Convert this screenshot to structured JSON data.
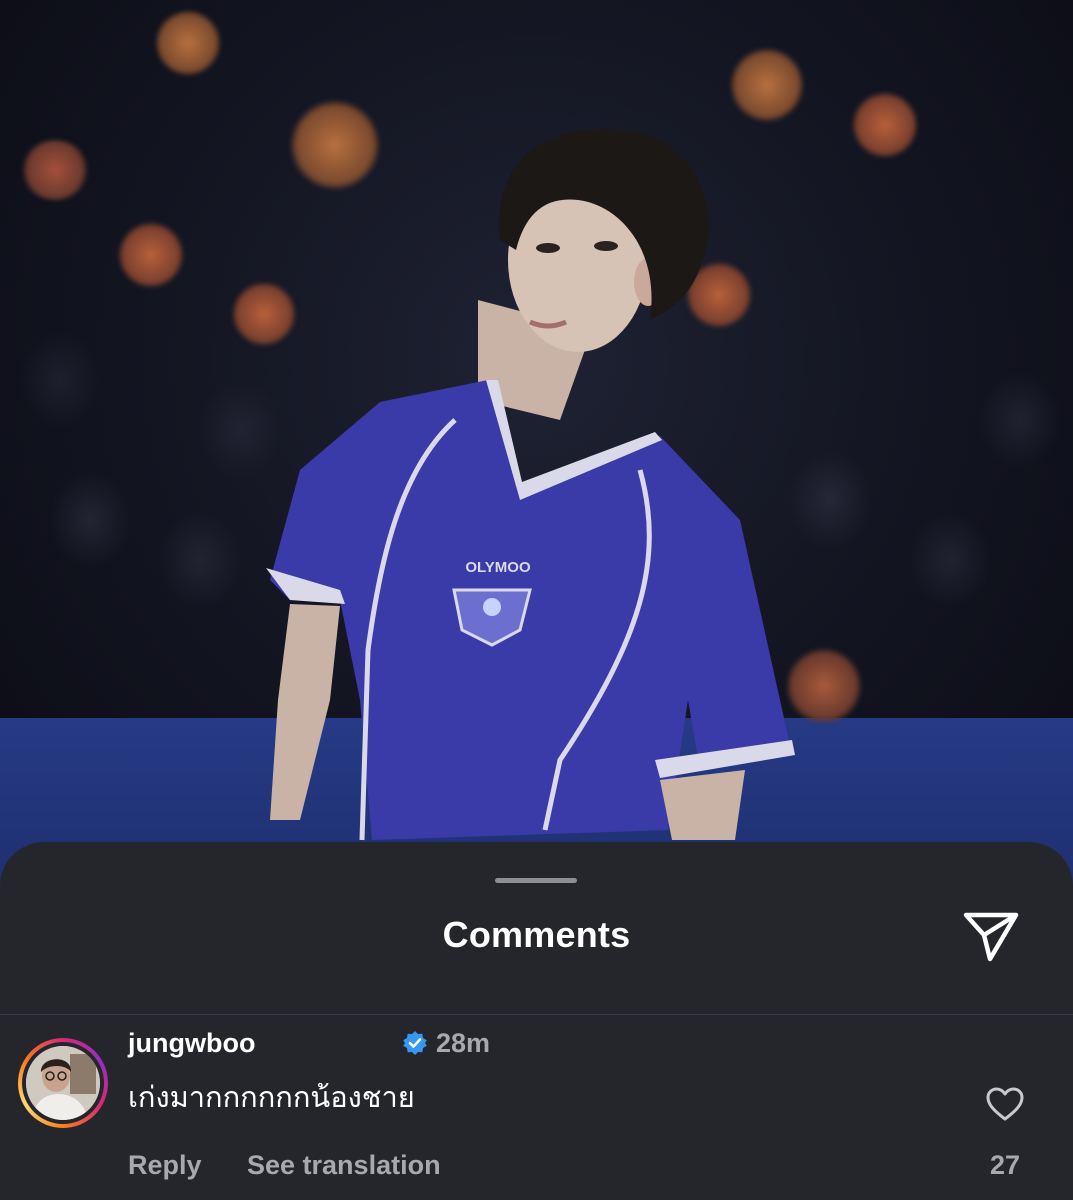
{
  "post": {
    "jersey_text": "OLYMOO"
  },
  "comments_sheet": {
    "title": "Comments",
    "share_icon": "send-icon"
  },
  "comment": {
    "username": "jungwboo",
    "verified_icon": "verified-badge-icon",
    "time": "28m",
    "text": "เก่งมากกกกกกน้องชาย",
    "reply_label": "Reply",
    "translate_label": "See translation",
    "like_icon": "heart-outline-icon",
    "like_count": "27"
  },
  "colors": {
    "sheet_bg": "#25262c",
    "verified_blue": "#3897f0",
    "jersey_blue": "#3a3aa8"
  }
}
